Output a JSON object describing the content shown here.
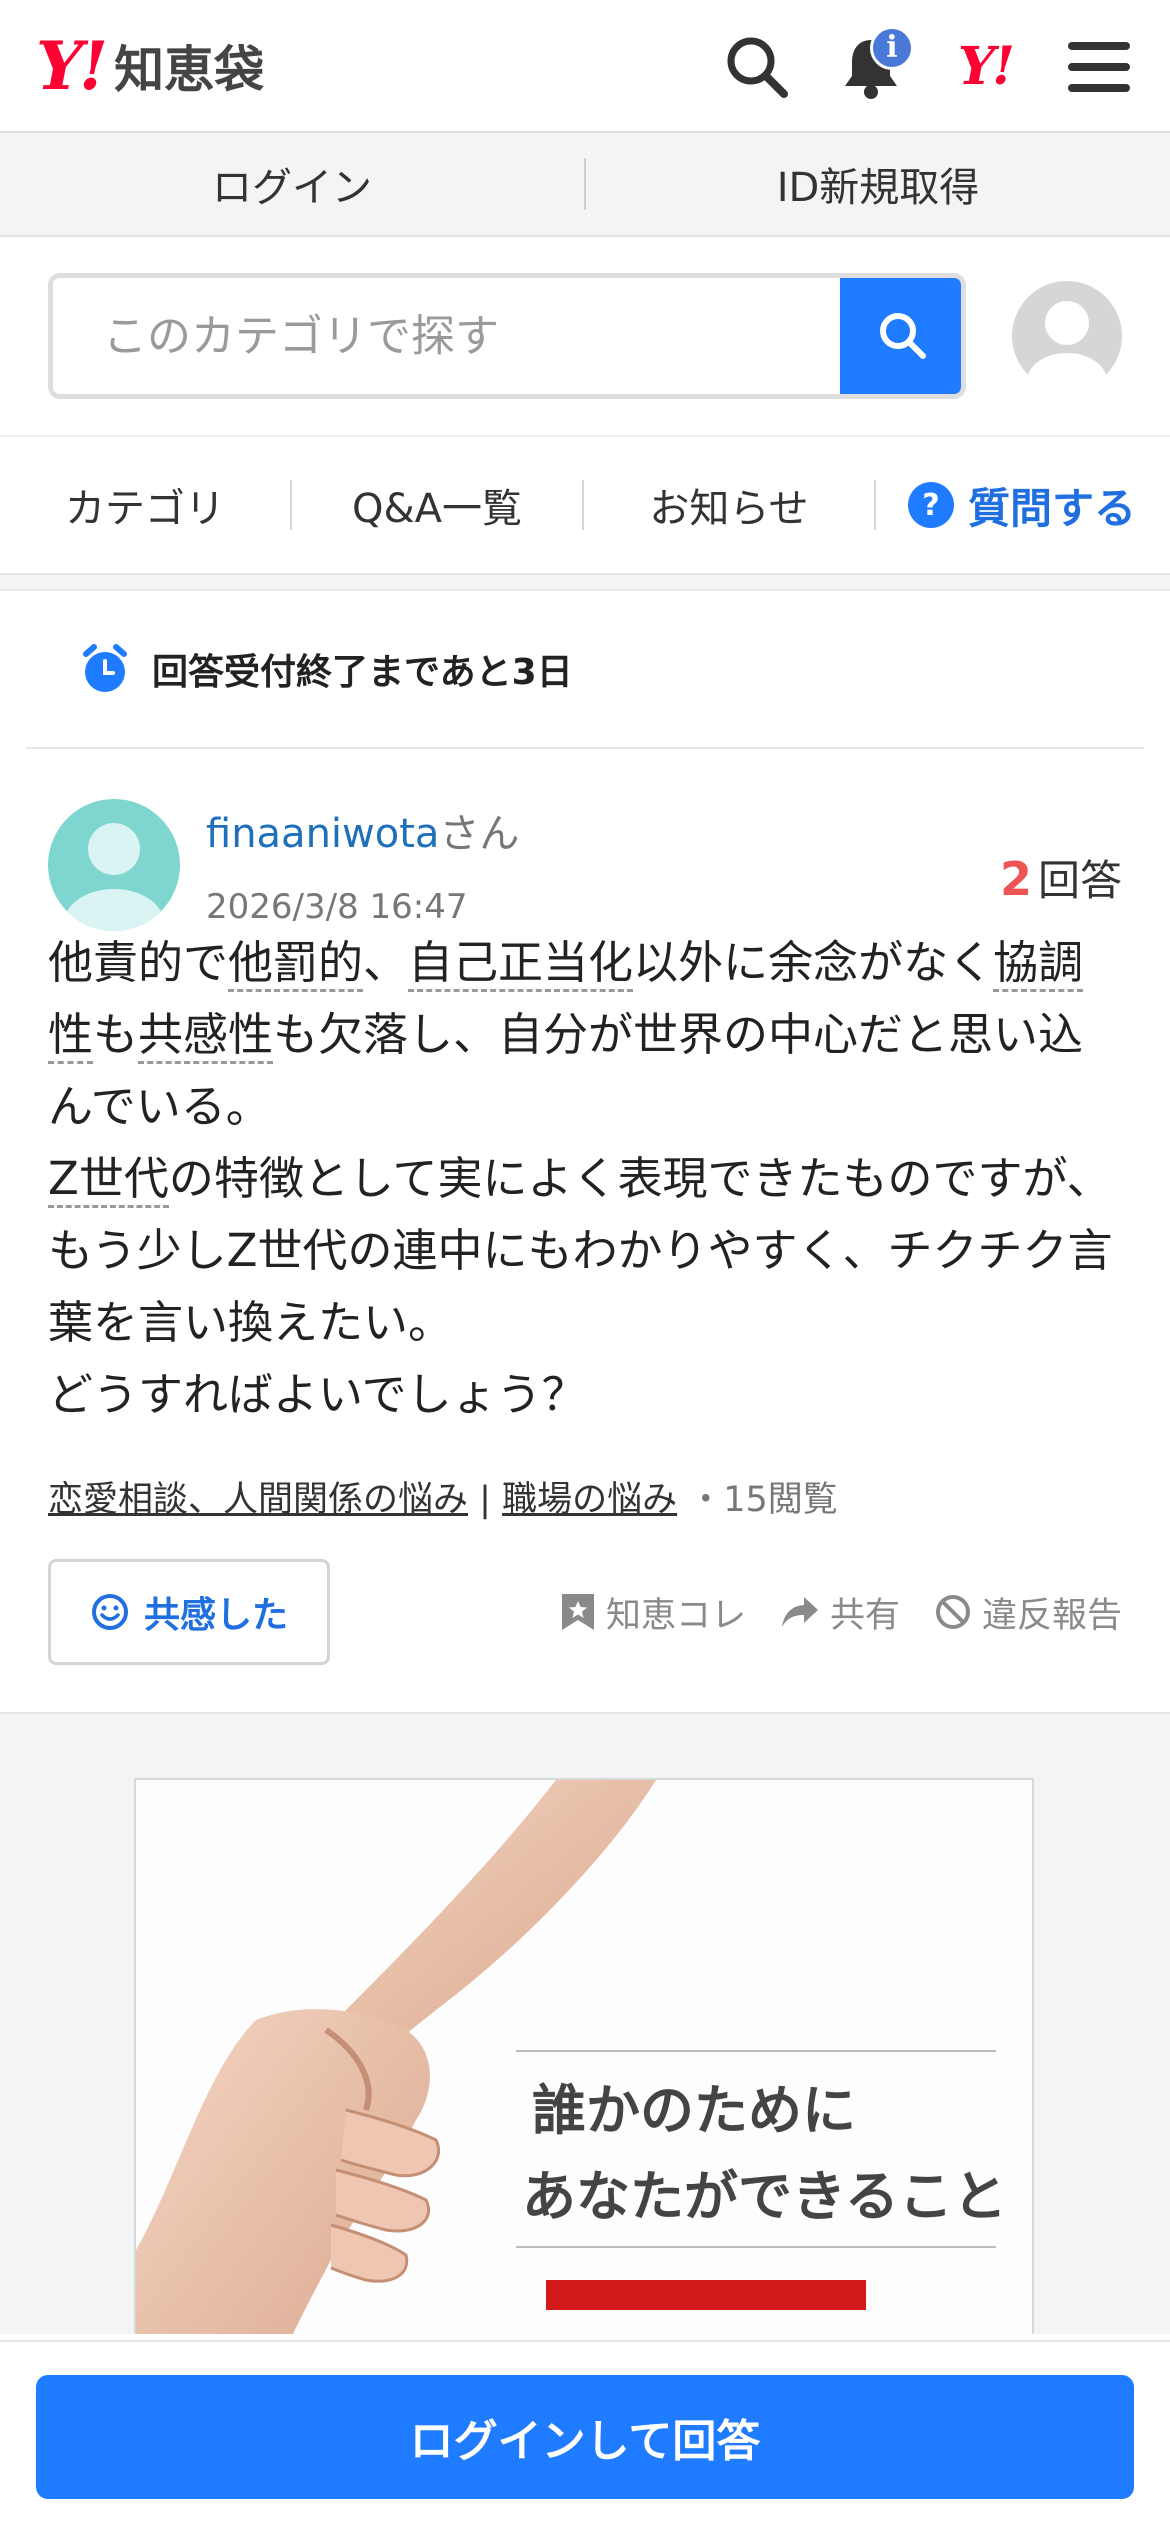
{
  "header": {
    "logo_mark": "Y!",
    "logo_text": "知恵袋",
    "notification_badge": "i",
    "yahoo_mini": "Y!"
  },
  "auth": {
    "login": "ログイン",
    "register": "ID新規取得"
  },
  "search": {
    "placeholder": "このカテゴリで探す"
  },
  "nav": {
    "items": [
      "カテゴリ",
      "Q&A一覧",
      "お知らせ"
    ],
    "ask_label": "質問する",
    "ask_icon": "?"
  },
  "deadline": {
    "text": "回答受付終了まであと3日"
  },
  "question": {
    "user": "finaaniwota",
    "user_suffix": "さん",
    "date": "2026/3/8 16:47",
    "answer_count": "2",
    "answer_label": "回答",
    "body_segments": [
      "他責的で",
      "他罰的",
      "、",
      "自己正当化",
      "以外に余念がなく",
      "協調性",
      "も",
      "共感性",
      "も欠落し、自分が世界の中心だと思い込んでいる。",
      "Z世代",
      "の特徴として実によく表現できたものですが、もう少しZ世代の連中にもわかりやすく、チクチク言葉を言い換えたい。",
      "どうすればよいでしょう？"
    ],
    "category1": "恋愛相談、人間関係の悩み",
    "category_sep": "|",
    "category2": "職場の悩み",
    "views": "・15閲覧"
  },
  "actions": {
    "empathy": "共感した",
    "save": "知恵コレ",
    "share": "共有",
    "report": "違反報告"
  },
  "ad": {
    "line1": "誰かのために",
    "line2": "あなたができること"
  },
  "cta": {
    "label": "ログインして回答"
  },
  "colors": {
    "brand_red": "#ff0033",
    "accent_blue": "#1f7bff",
    "answer_count": "#ef5454",
    "link_blue": "#1f6fba"
  }
}
